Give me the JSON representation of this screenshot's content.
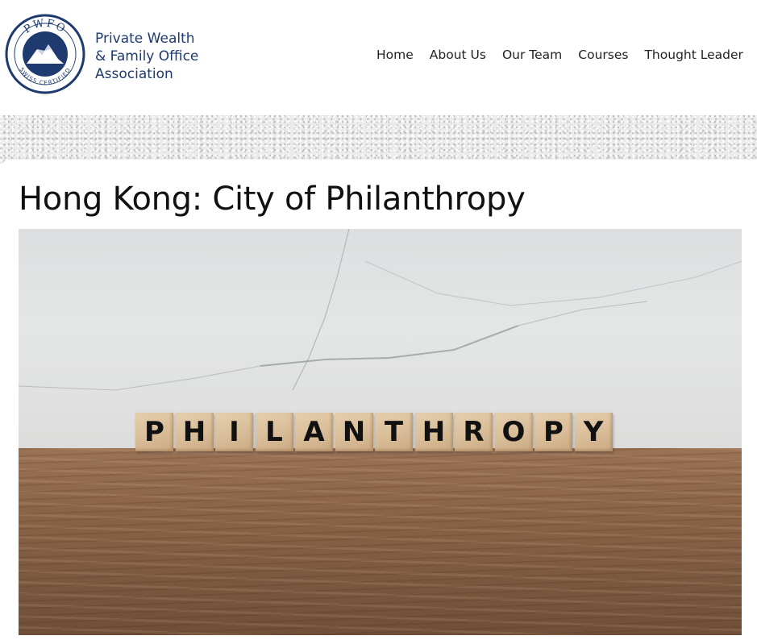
{
  "header": {
    "logo": {
      "badge_top_text": "PWFO",
      "badge_bottom_text": "SWISS CERTIFIED",
      "lines": [
        "Private Wealth",
        "& Family Office",
        "Association"
      ],
      "brand_color": "#1e3a6e"
    },
    "nav": [
      "Home",
      "About Us",
      "Our Team",
      "Courses",
      "Thought Leader"
    ]
  },
  "post": {
    "title": "Hong Kong: City of Philanthropy",
    "image": {
      "blocks": [
        "P",
        "H",
        "I",
        "L",
        "A",
        "N",
        "T",
        "H",
        "R",
        "O",
        "P",
        "Y"
      ]
    }
  }
}
